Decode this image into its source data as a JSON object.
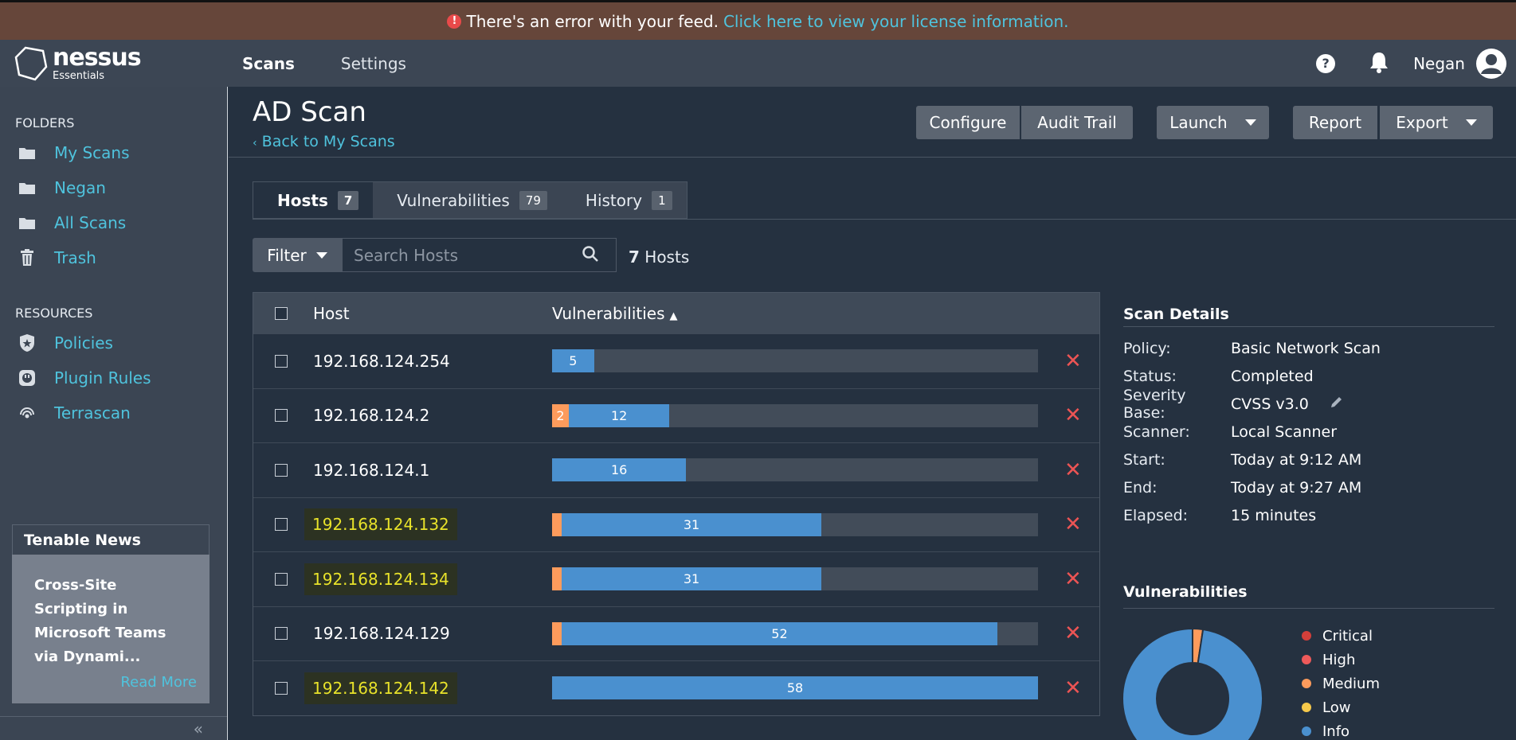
{
  "banner": {
    "text": "There's an error with your feed.",
    "link": "Click here to view your license information."
  },
  "nav": {
    "brand": "nessus",
    "edition": "Essentials",
    "tabs": [
      "Scans",
      "Settings"
    ],
    "help": "?",
    "user": "Negan"
  },
  "sidebar": {
    "folders_title": "FOLDERS",
    "folders": [
      {
        "label": "My Scans",
        "icon": "folder-icon"
      },
      {
        "label": "Negan",
        "icon": "folder-icon"
      },
      {
        "label": "All Scans",
        "icon": "folder-icon"
      },
      {
        "label": "Trash",
        "icon": "trash-icon"
      }
    ],
    "resources_title": "RESOURCES",
    "resources": [
      {
        "label": "Policies",
        "icon": "policy-shield-icon"
      },
      {
        "label": "Plugin Rules",
        "icon": "plug-icon"
      },
      {
        "label": "Terrascan",
        "icon": "radar-icon"
      }
    ],
    "news": {
      "title": "Tenable News",
      "headline": "Cross-Site Scripting in Microsoft Teams via Dynami...",
      "read_more": "Read More"
    },
    "collapse": "«"
  },
  "scan": {
    "title": "AD Scan",
    "back": "Back to My Scans",
    "buttons": {
      "configure": "Configure",
      "audit": "Audit Trail",
      "launch": "Launch",
      "report": "Report",
      "export": "Export"
    },
    "tabs": [
      {
        "label": "Hosts",
        "count": "7"
      },
      {
        "label": "Vulnerabilities",
        "count": "79"
      },
      {
        "label": "History",
        "count": "1"
      }
    ],
    "filter": "Filter",
    "search_placeholder": "Search Hosts",
    "host_count": "7",
    "host_count_label": "Hosts",
    "columns": {
      "host": "Host",
      "vulns": "Vulnerabilities",
      "sort": "▲"
    }
  },
  "colors": {
    "critical": "#d43f3a",
    "high": "#ee5a5a",
    "medium": "#fd9b5c",
    "low": "#f6c94b",
    "info": "#4a90cf"
  },
  "hosts": [
    {
      "ip": "192.168.124.254",
      "highlight": false,
      "medium": 0,
      "info": 5,
      "total": 5
    },
    {
      "ip": "192.168.124.2",
      "highlight": false,
      "medium": 2,
      "info": 12,
      "total": 14
    },
    {
      "ip": "192.168.124.1",
      "highlight": false,
      "medium": 0,
      "info": 16,
      "total": 16
    },
    {
      "ip": "192.168.124.132",
      "highlight": true,
      "medium": 1,
      "info": 31,
      "total": 32
    },
    {
      "ip": "192.168.124.134",
      "highlight": true,
      "medium": 1,
      "info": 31,
      "total": 32
    },
    {
      "ip": "192.168.124.129",
      "highlight": false,
      "medium": 1,
      "info": 52,
      "total": 53
    },
    {
      "ip": "192.168.124.142",
      "highlight": true,
      "medium": 0,
      "info": 58,
      "total": 58
    }
  ],
  "details": {
    "title": "Scan Details",
    "rows": [
      {
        "k": "Policy:",
        "v": "Basic Network Scan"
      },
      {
        "k": "Status:",
        "v": "Completed"
      },
      {
        "k": "Severity Base:",
        "v": "CVSS v3.0"
      },
      {
        "k": "Scanner:",
        "v": "Local Scanner"
      },
      {
        "k": "Start:",
        "v": "Today at 9:12 AM"
      },
      {
        "k": "End:",
        "v": "Today at 9:27 AM"
      },
      {
        "k": "Elapsed:",
        "v": "15 minutes"
      }
    ]
  },
  "vuln_summary": {
    "title": "Vulnerabilities",
    "legend": [
      "Critical",
      "High",
      "Medium",
      "Low",
      "Info"
    ]
  }
}
